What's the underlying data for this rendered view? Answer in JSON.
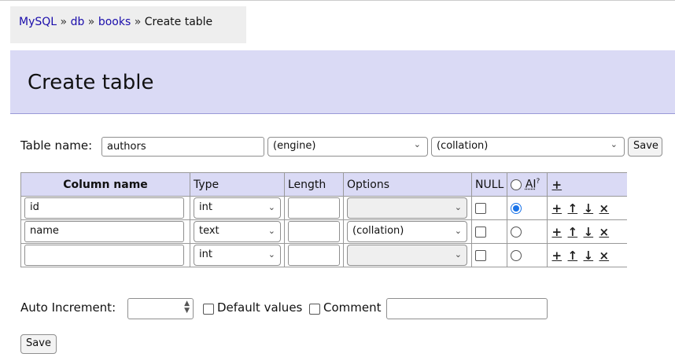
{
  "breadcrumb": {
    "items": [
      "MySQL",
      "db",
      "books"
    ],
    "separator": "»",
    "current": "Create table"
  },
  "header": {
    "title": "Create table"
  },
  "form": {
    "table_name_label": "Table name:",
    "table_name_value": "authors",
    "engine_select": "(engine)",
    "collation_select": "(collation)",
    "save_label": "Save"
  },
  "columns_table": {
    "headers": {
      "column_name": "Column name",
      "type": "Type",
      "length": "Length",
      "options": "Options",
      "null": "NULL",
      "ai": "AI",
      "ai_sup": "?",
      "add": "+"
    },
    "rows": [
      {
        "name": "id",
        "type": "int",
        "length": "",
        "options": "",
        "null": false,
        "ai": true
      },
      {
        "name": "name",
        "type": "text",
        "length": "",
        "options": "(collation)",
        "null": false,
        "ai": false
      },
      {
        "name": "",
        "type": "int",
        "length": "",
        "options": "",
        "null": false,
        "ai": false
      }
    ],
    "row_actions": [
      "+",
      "↑",
      "↓",
      "×"
    ]
  },
  "bottom": {
    "auto_increment_label": "Auto Increment:",
    "auto_increment_value": "",
    "default_values_label": "Default values",
    "comment_label": "Comment",
    "comment_value": "",
    "save_label": "Save"
  },
  "colors": {
    "header_bg": "#dadaf5",
    "breadcrumb_bg": "#eeeeee",
    "link": "#1a0dab",
    "radio_selected": "#1a73e8"
  }
}
